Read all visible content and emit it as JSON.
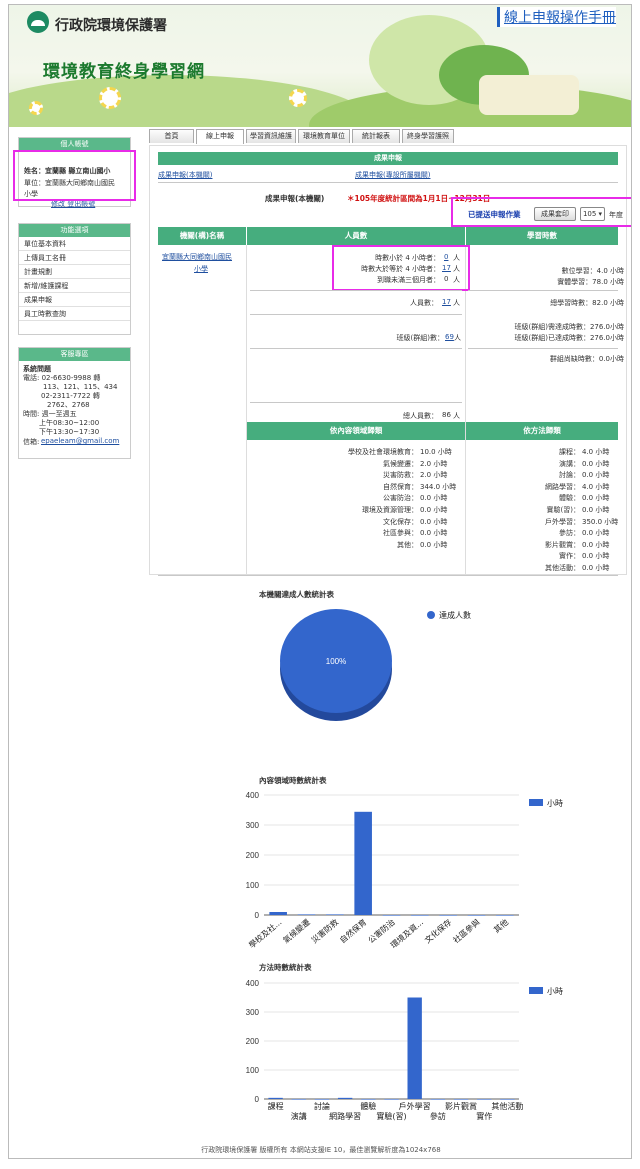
{
  "header": {
    "org": "行政院環境保護署",
    "site_title": "環境教育終身學習網",
    "manual_link": "線上申報操作手冊"
  },
  "tabs": [
    "首頁",
    "線上申報",
    "學習資訊維護",
    "環境教育單位",
    "統計報表",
    "終身學習護照"
  ],
  "user": {
    "header": "個人帳號",
    "name": "姓名：宜蘭縣 縣立南山國小",
    "unit_line1": "單位：宜蘭縣大同鄉南山國民",
    "unit_line2": "小學",
    "links": "修改 登出帳號"
  },
  "menu": {
    "header": "功能選項",
    "items": [
      "單位基本資料",
      "上傳員工名冊",
      "計畫規劃",
      "新增/維護課程",
      "成果申報",
      "員工時數查詢"
    ]
  },
  "service": {
    "header": "客服專區",
    "lines": [
      "系統問題",
      "電話: 02-6630-9988 轉",
      "113、121、115、434",
      "02-2311-7722 轉",
      "2762、2768",
      "時間: 週一至週五",
      "上午08:30~12:00",
      "下午13:30~17:30",
      "信箱:"
    ],
    "email": "epaeleam@gmail.com"
  },
  "main": {
    "header": "成果申報",
    "link1": "成果申報(本機關)",
    "link2": "成果申報(專設所屬機關)",
    "title_prefix": "成果申報(本機關)",
    "title_note": "＊105年度統計區間為1月1日~12月31日",
    "submitted": "已提送申報作業",
    "print_button": "成果套印",
    "year": "105",
    "year_suffix": "年度"
  },
  "table": {
    "col_org": "機關(構)名稱",
    "col_people": "人員數",
    "col_hours": "學習時數",
    "org_name_1": "宜蘭縣大同鄉南山國民",
    "org_name_2": "小學",
    "less4_label": "時數小於 4 小時者：",
    "less4_value": "0",
    "ge4_label": "時數大於等於 4 小時者：",
    "ge4_value": "17",
    "new_label": "到職未滿三個月者：",
    "new_value": "0",
    "unit_ren": "人",
    "people_label": "人員數：",
    "people_value": "17",
    "class_label": "班級(群組)數：",
    "class_value": "69",
    "total_label": "總人員數：",
    "total_value": "86",
    "digital": "數位學習：4.0 小時",
    "physical": "實體學習：78.0 小時",
    "total_hours": "總學習時數：82.0 小時",
    "class_should": "班級(群組)需達成時數：276.0小時",
    "class_done": "班級(群組)已達成時數：276.0小時",
    "class_short": "群組尚缺時數：0.0小時",
    "content_hd": "依內容領域歸類",
    "method_hd": "依方法歸類"
  },
  "content_rows": [
    [
      "學校及社會環境教育：",
      "10.0 小時"
    ],
    [
      "氣候變遷：",
      "2.0 小時"
    ],
    [
      "災害防救：",
      "2.0 小時"
    ],
    [
      "自然保育：",
      "344.0 小時"
    ],
    [
      "公害防治：",
      "0.0 小時"
    ],
    [
      "環境及資源管理：",
      "0.0 小時"
    ],
    [
      "文化保存：",
      "0.0 小時"
    ],
    [
      "社區參與：",
      "0.0 小時"
    ],
    [
      "其他：",
      "0.0 小時"
    ]
  ],
  "method_rows": [
    [
      "課程：",
      "4.0 小時"
    ],
    [
      "演講：",
      "0.0 小時"
    ],
    [
      "討論：",
      "0.0 小時"
    ],
    [
      "網路學習：",
      "4.0 小時"
    ],
    [
      "體驗：",
      "0.0 小時"
    ],
    [
      "實驗(習)：",
      "0.0 小時"
    ],
    [
      "戶外學習：",
      "350.0 小時"
    ],
    [
      "參訪：",
      "0.0 小時"
    ],
    [
      "影片觀賞：",
      "0.0 小時"
    ],
    [
      "實作：",
      "0.0 小時"
    ],
    [
      "其他活動：",
      "0.0 小時"
    ]
  ],
  "chart_data": [
    {
      "type": "pie",
      "title": "本機關達成人數統計表",
      "labels": [
        "達成人數"
      ],
      "values": [
        100
      ],
      "slice_label": "100%",
      "colors": [
        "#3366cc"
      ]
    },
    {
      "type": "bar",
      "title": "內容領域時數統計表",
      "categories": [
        "學校及社...",
        "氣候變遷",
        "災害防救",
        "自然保育",
        "公害防治",
        "環境及資...",
        "文化保存",
        "社區參與",
        "其他"
      ],
      "series": [
        {
          "name": "小時",
          "values": [
            10,
            2,
            2,
            344,
            0,
            0,
            0,
            0,
            0
          ]
        }
      ],
      "ylim": [
        0,
        400
      ],
      "yticks": [
        0,
        100,
        200,
        300,
        400
      ]
    },
    {
      "type": "bar",
      "title": "方法時數統計表",
      "categories": [
        "課程",
        "演講",
        "討論",
        "網路學習",
        "體驗",
        "實驗(習)",
        "戶外學習",
        "參訪",
        "影片觀賞",
        "實作",
        "其他活動"
      ],
      "series": [
        {
          "name": "小時",
          "values": [
            4,
            0,
            0,
            4,
            0,
            0,
            350,
            0,
            0,
            0,
            0
          ]
        }
      ],
      "ylim": [
        0,
        400
      ],
      "yticks": [
        0,
        100,
        200,
        300,
        400
      ]
    }
  ],
  "footer": "行政院環境保護署 版權所有 本網站支援IE 10，最佳瀏覽解析度為1024x768"
}
